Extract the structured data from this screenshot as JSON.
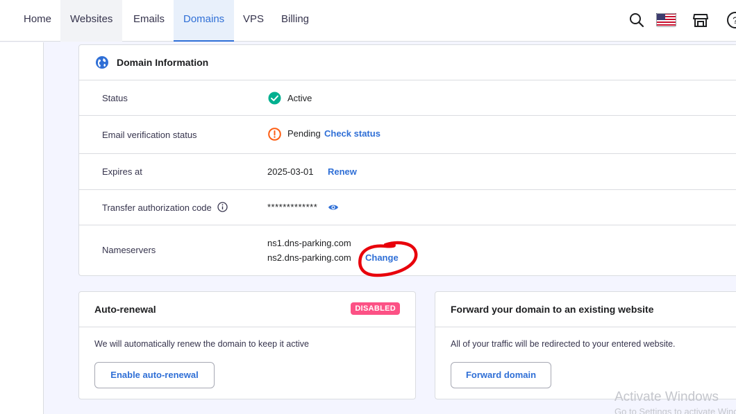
{
  "nav": {
    "items": [
      {
        "label": "Home"
      },
      {
        "label": "Websites"
      },
      {
        "label": "Emails"
      },
      {
        "label": "Domains"
      },
      {
        "label": "VPS"
      },
      {
        "label": "Billing"
      }
    ],
    "active": "Domains",
    "icons": [
      "search-icon",
      "us-flag-icon",
      "store-icon",
      "help-icon"
    ]
  },
  "domain_info": {
    "title": "Domain Information",
    "rows": {
      "status": {
        "label": "Status",
        "value": "Active"
      },
      "email_verification": {
        "label": "Email verification status",
        "value": "Pending",
        "action": "Check status"
      },
      "expires": {
        "label": "Expires at",
        "value": "2025-03-01",
        "action": "Renew"
      },
      "auth_code": {
        "label": "Transfer authorization code",
        "value": "*************"
      },
      "nameservers": {
        "label": "Nameservers",
        "ns1": "ns1.dns-parking.com",
        "ns2": "ns2.dns-parking.com",
        "action": "Change"
      }
    }
  },
  "auto_renewal": {
    "title": "Auto-renewal",
    "badge": "DISABLED",
    "description": "We will automatically renew the domain to keep it active",
    "button": "Enable auto-renewal"
  },
  "forward": {
    "title": "Forward your domain to an existing website",
    "description": "All of your traffic will be redirected to your entered website.",
    "button": "Forward domain"
  },
  "watermark": {
    "line1": "Activate Windows",
    "line2": "Go to Settings to activate Windows."
  },
  "colors": {
    "accent": "#2f6fd6",
    "success": "#00b090",
    "warning": "#fd5d12",
    "badge": "#fc5185",
    "annotation": "#e8000b"
  }
}
